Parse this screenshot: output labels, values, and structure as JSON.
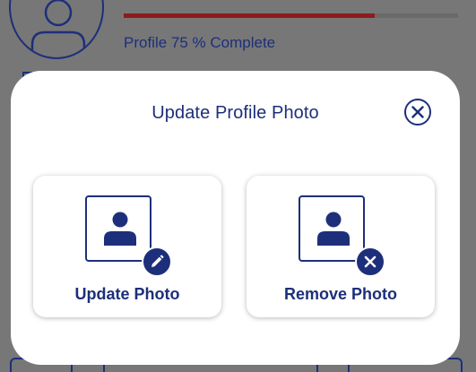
{
  "background": {
    "progress": {
      "fraction": 0.75,
      "label": "Profile 75 % Complete",
      "fill_color": "#8e1c1c"
    },
    "avatar_icon": "user-icon"
  },
  "modal": {
    "title": "Update Profile Photo",
    "close_icon": "close-icon",
    "options": [
      {
        "label": "Update Photo",
        "icon": "person-photo-icon",
        "badge_icon": "pencil-icon"
      },
      {
        "label": "Remove Photo",
        "icon": "person-photo-icon",
        "badge_icon": "close-icon"
      }
    ]
  },
  "colors": {
    "primary": "#1d2f7a",
    "overlay": "#777777",
    "surface": "#ffffff"
  }
}
